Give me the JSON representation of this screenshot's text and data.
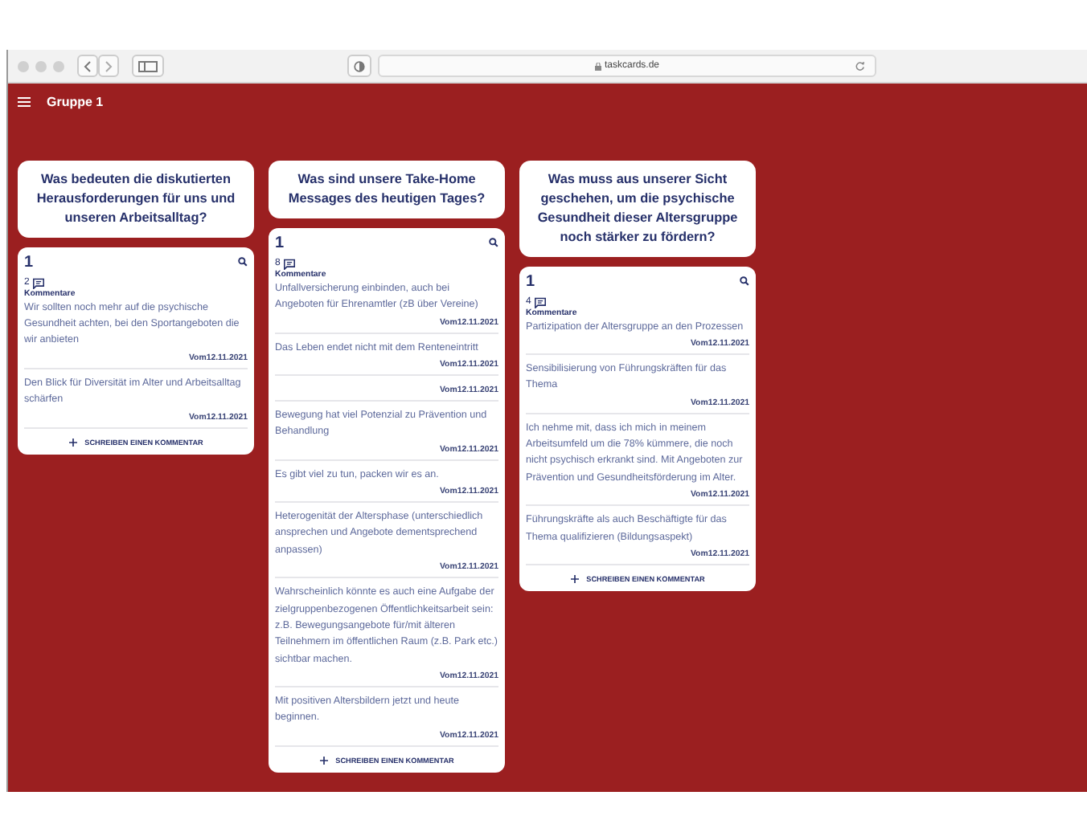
{
  "browser": {
    "address": "taskcards.de"
  },
  "board": {
    "title": "Gruppe 1"
  },
  "columns": [
    {
      "heading": "Was bedeuten die diskutierten Herausforderungen für uns und unseren Arbeitsalltag?",
      "card": {
        "title": "1",
        "count": "2",
        "comments_label": "Kommentare",
        "comments": [
          {
            "text": "Wir sollten noch mehr auf die psychische Gesundheit achten, bei den Sportangeboten die wir anbieten",
            "date": "Vom12.11.2021"
          },
          {
            "text": "Den Blick für Diversität im Alter und Arbeitsalltag schärfen",
            "date": "Vom12.11.2021"
          }
        ],
        "action": "SCHREIBEN EINEN KOMMENTAR"
      }
    },
    {
      "heading": "Was sind unsere Take-Home Messages des heutigen Tages?",
      "card": {
        "title": "1",
        "count": "8",
        "comments_label": "Kommentare",
        "comments": [
          {
            "text": "Unfallversicherung einbinden, auch bei Angeboten für Ehrenamtler (zB über Vereine)",
            "date": "Vom12.11.2021"
          },
          {
            "text": "Das Leben endet nicht mit dem Renteneintritt",
            "date": "Vom12.11.2021"
          },
          {
            "date": "Vom12.11.2021"
          },
          {
            "text": "Bewegung hat viel Potenzial zu Prävention und Behandlung",
            "date": "Vom12.11.2021"
          },
          {
            "text": "Es gibt viel zu tun, packen wir es an.",
            "date": "Vom12.11.2021"
          },
          {
            "text": "Heterogenität der Altersphase (unterschiedlich ansprechen und Angebote dementsprechend anpassen)",
            "date": "Vom12.11.2021"
          },
          {
            "text": "Wahrscheinlich könnte es auch eine Aufgabe der zielgruppenbezogenen Öffentlichkeitsarbeit sein: z.B. Bewegungsangebote für/mit älteren Teilnehmern im öffentlichen Raum (z.B. Park etc.) sichtbar machen.",
            "date": "Vom12.11.2021"
          },
          {
            "text": "Mit positiven Altersbildern jetzt und heute beginnen.",
            "date": "Vom12.11.2021"
          }
        ],
        "action": "SCHREIBEN EINEN KOMMENTAR"
      }
    },
    {
      "heading": "Was muss aus unserer Sicht geschehen, um die psychische Gesundheit dieser Altersgruppe noch stärker zu fördern?",
      "card": {
        "title": "1",
        "count": "4",
        "comments_label": "Kommentare",
        "comments": [
          {
            "text": "Partizipation der Altersgruppe an den Prozessen",
            "date": "Vom12.11.2021"
          },
          {
            "text": "Sensibilisierung von Führungskräften für das Thema",
            "date": "Vom12.11.2021"
          },
          {
            "text": "Ich nehme mit, dass ich mich in meinem Arbeitsumfeld um die 78% kümmere, die noch nicht psychisch erkrankt sind. Mit Angeboten zur Prävention und Gesundheitsförderung im Alter.",
            "date": "Vom12.11.2021"
          },
          {
            "text": "Führungskräfte als auch Beschäftigte für das Thema qualifizieren (Bildungsaspekt)",
            "date": "Vom12.11.2021"
          }
        ],
        "action": "SCHREIBEN EINEN KOMMENTAR"
      }
    }
  ]
}
